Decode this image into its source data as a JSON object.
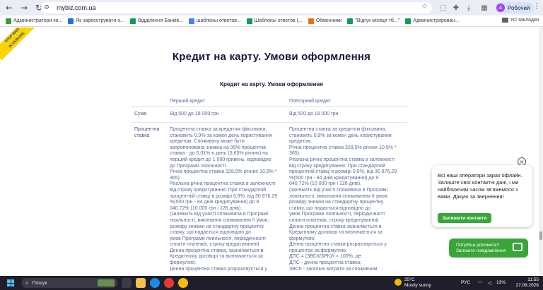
{
  "browser": {
    "url": "mybiz.com.ua",
    "profile_name": "Робочий",
    "profile_initial": "A",
    "bookmarks": [
      {
        "label": "Администратори ко...",
        "color": "#2f9e44"
      },
      {
        "label": "Як зареєструвати о...",
        "color": "#1a73e8"
      },
      {
        "label": "Відділення Банків...",
        "color": "#0f9d58"
      },
      {
        "label": "шаблоны ответов...",
        "color": "#4285f4"
      },
      {
        "label": "Шаблоны ответов (...",
        "color": "#0f9d58"
      },
      {
        "label": "Обменники",
        "color": "#e8710a"
      },
      {
        "label": "\"Відгук місяця тб...\"",
        "color": "#0f9d58"
      },
      {
        "label": "Администрирован...",
        "color": "#0f9d58"
      }
    ],
    "all_bookmarks_label": "Усі закладки"
  },
  "ribbon": {
    "line1": "STOP WAR",
    "line2": "IN UKRAINE"
  },
  "page": {
    "title": "Кредит на карту. Умови оформлення",
    "table_title": "Кредит на карту. Умови оформлення",
    "col_first": "Перший кредит",
    "col_repeat": "Повторний кредит",
    "row_sum_label": "Сума",
    "row_sum_first": "Від 500 до 18 000 грн",
    "row_sum_repeat": "Від 500 до 18 000 грн",
    "row_rate_label_1": "Процентна",
    "row_rate_label_2": "ставка",
    "rate_first_lines": [
      "Процентна ставка за кредитом фіксована,",
      "становить 0.9% за кожен день користування",
      "кредитом. Споживачу може бути",
      "запропонована знижка на 99% процентна",
      "ставка - до 0,01% в день (3,65% річних) на",
      "перший кредит до 1 000 гривень, відповідно",
      "до Програми лояльності.",
      "Річна процентна ставка 328,5%  річних 10,9% *",
      "365).",
      "Реальна річна процентна ставка в залежності",
      "від строку кредитування: При стандартній",
      "процентній ставці в розмірі 0,9%, від 30 876,29",
      "%(500 грн - 84 днів кредитування) до 9",
      "040,72% (10 000 грн і 126 днів).",
      "(залежить від участі споживача в Програмі",
      "лояльності, виконання споживачем її умов,",
      "розміру знижки на стандартну процентну",
      "ставку, що надається відповідно до",
      "умов Програми лояльності, періодичності",
      "сплати платежів, строку кредитування)",
      "Денна процентна ставка, зазначається в",
      "Кредитному договорі та визначається за",
      "формулою:",
      "Денна процентна ставка розраховується у"
    ],
    "rate_repeat_lines": [
      "Процентна ставка за кредитом фіксована,",
      "становить 0.9% за кожен день користування",
      "кредитом.",
      "Річна процентна ставка 328,5%  річних 10,9% *",
      "365).",
      "Реальна річна процентна ставка в залежності",
      "від строку кредитування: При стандартній",
      "процентній ставці в розмірі 0,9%, від 30 876,29",
      "%(500 грн - 84 днів кредитування) до 9",
      "040,72% (10 000 грн і 126 днів).",
      "(залежить від участі споживача в Програмі",
      "лояльності, виконання споживачем її умов,",
      "розміру знижки на стандартну процентну",
      "ставку, що надається відповідно до",
      "умов Програми лояльності, періодичності",
      "сплати платежів, строку кредитування)",
      "Денна процентна ставка зазначається в",
      "Кредитному договорі та визначається за",
      "формулою:",
      "Денна процентна ставка розраховується у",
      "процентах за формулою:",
      "ДПС = (ЗВСК/ЗРК)/t × 100%, де",
      "ДПС - денна процентна ставка;",
      "ЗВСК - загальні витрати за споживчим"
    ]
  },
  "chat": {
    "message": "Всі наші оператори зараз офлайн. Залиште свої контактні дані, і ми найближчим часом зв'яжемося з вами. Дякую за звернення!",
    "contact_button": "Залишити контакти",
    "launcher_line1": "Потрібна допомога?",
    "launcher_line2": "Залиште повідомлення",
    "accent": "#3aa63a"
  },
  "taskbar": {
    "search_placeholder": "Пошук",
    "temperature": "25°C",
    "weather": "Mostly sunny",
    "language": "РУС",
    "battery": "13%",
    "time": "11:55",
    "date": "27.08.2026"
  }
}
